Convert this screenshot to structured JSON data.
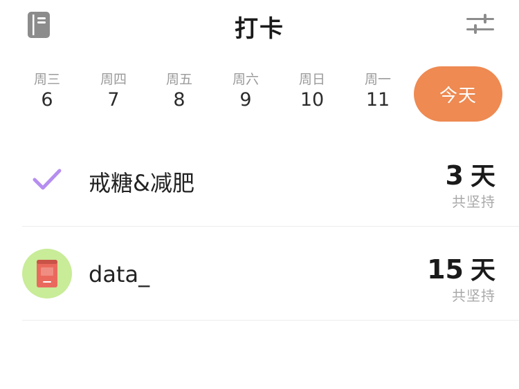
{
  "header": {
    "title": "打卡",
    "left_icon": "journal-icon",
    "right_icon": "filter-sliders-icon"
  },
  "week": {
    "days": [
      {
        "weekday": "周三",
        "date": "6"
      },
      {
        "weekday": "周四",
        "date": "7"
      },
      {
        "weekday": "周五",
        "date": "8"
      },
      {
        "weekday": "周六",
        "date": "9"
      },
      {
        "weekday": "周日",
        "date": "10"
      },
      {
        "weekday": "周一",
        "date": "11"
      }
    ],
    "today_label": "今天"
  },
  "habits": [
    {
      "name": "戒糖&减肥",
      "icon": "checkmark-icon",
      "count": "3",
      "unit": "天",
      "caption": "共坚持"
    },
    {
      "name": "data_",
      "icon": "book-icon",
      "count": "15",
      "unit": "天",
      "caption": "共坚持"
    }
  ],
  "colors": {
    "accent": "#ee8a52",
    "check": "#b58ef0",
    "book_bg": "#c8ec98",
    "book": "#e96a5d",
    "icon_gray": "#8c8c8c"
  }
}
